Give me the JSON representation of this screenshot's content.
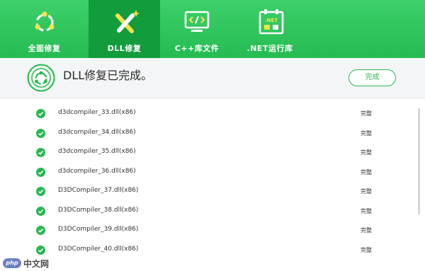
{
  "nav": {
    "tabs": [
      {
        "label": "全面修复",
        "icon": "recycle-icon"
      },
      {
        "label": "DLL修复",
        "icon": "tools-icon"
      },
      {
        "label": "C++库文件",
        "icon": "code-monitor-icon"
      },
      {
        ".NET_label": "",
        "label": ".NET运行库",
        "icon": "net-calendar-icon",
        "badge": ".NET"
      }
    ],
    "active_index": 1
  },
  "status": {
    "title": "DLL修复已完成。",
    "button_label": "完成"
  },
  "files": [
    {
      "name": "d3dcompiler_33.dll(x86)",
      "state": "完整"
    },
    {
      "name": "d3dcompiler_34.dll(x86)",
      "state": "完整"
    },
    {
      "name": "d3dcompiler_35.dll(x86)",
      "state": "完整"
    },
    {
      "name": "d3dcompiler_36.dll(x86)",
      "state": "完整"
    },
    {
      "name": "D3DCompiler_37.dll(x86)",
      "state": "完整"
    },
    {
      "name": "D3DCompiler_38.dll(x86)",
      "state": "完整"
    },
    {
      "name": "D3DCompiler_39.dll(x86)",
      "state": "完整"
    },
    {
      "name": "D3DCompiler_40.dll(x86)",
      "state": "完整"
    }
  ],
  "watermark": {
    "logo": "php",
    "text": "中文网"
  },
  "colors": {
    "brand_green": "#28b84f",
    "active_tab": "#139c3c"
  }
}
